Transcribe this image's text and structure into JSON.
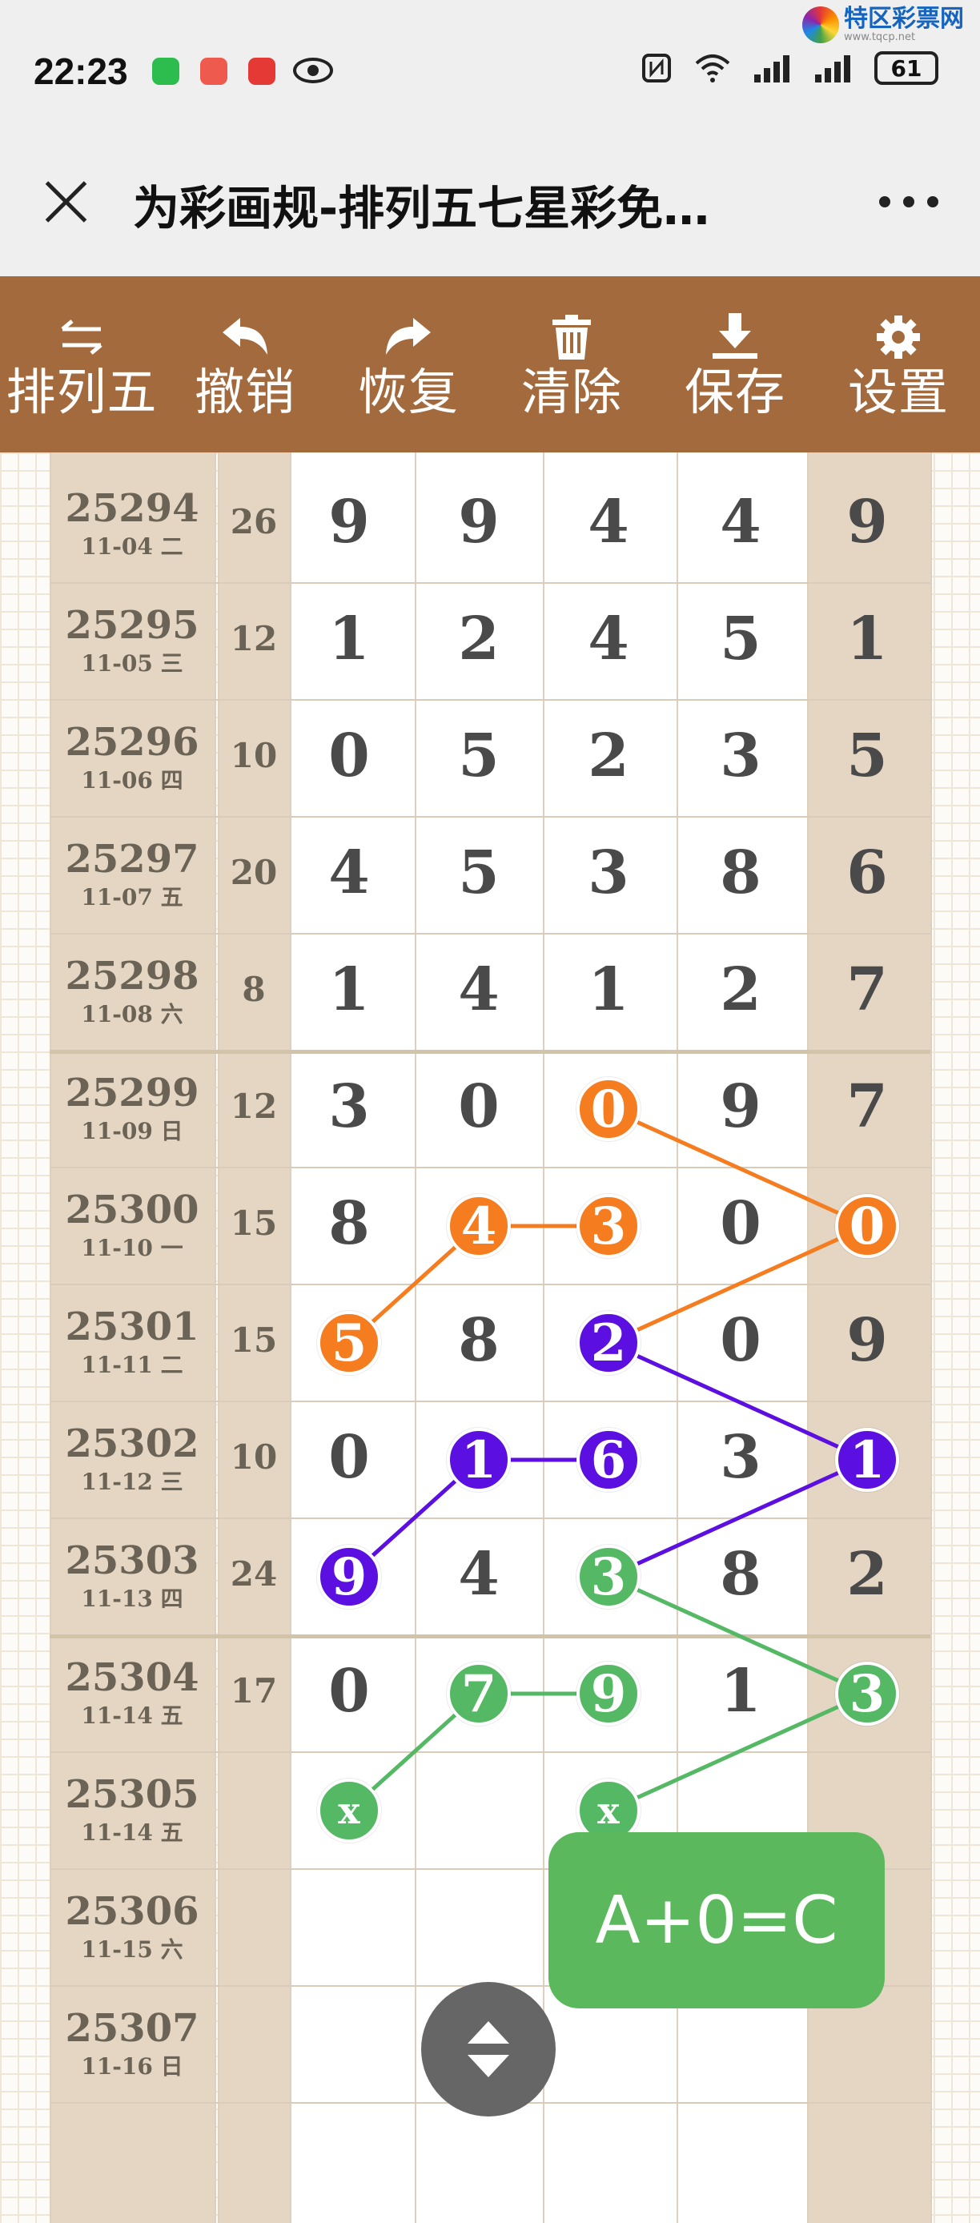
{
  "status": {
    "time": "22:23",
    "battery": "61",
    "watermark_text": "特区彩票网",
    "watermark_sub": "www.tqcp.net"
  },
  "header": {
    "title": "为彩画规-排列五七星彩免…"
  },
  "toolbar": [
    {
      "label": "排列五",
      "icon": "swap-arrows-icon"
    },
    {
      "label": "撤销",
      "icon": "undo-icon"
    },
    {
      "label": "恢复",
      "icon": "redo-icon"
    },
    {
      "label": "清除",
      "icon": "trash-icon"
    },
    {
      "label": "保存",
      "icon": "download-icon"
    },
    {
      "label": "设置",
      "icon": "gear-icon"
    }
  ],
  "rows": [
    {
      "issue": "25294",
      "date": "11-04 二",
      "sum": "26",
      "digits": [
        "9",
        "9",
        "4",
        "4",
        "9"
      ]
    },
    {
      "issue": "25295",
      "date": "11-05 三",
      "sum": "12",
      "digits": [
        "1",
        "2",
        "4",
        "5",
        "1"
      ]
    },
    {
      "issue": "25296",
      "date": "11-06 四",
      "sum": "10",
      "digits": [
        "0",
        "5",
        "2",
        "3",
        "5"
      ]
    },
    {
      "issue": "25297",
      "date": "11-07 五",
      "sum": "20",
      "digits": [
        "4",
        "5",
        "3",
        "8",
        "6"
      ]
    },
    {
      "issue": "25298",
      "date": "11-08 六",
      "sum": "8",
      "digits": [
        "1",
        "4",
        "1",
        "2",
        "7"
      ]
    },
    {
      "issue": "25299",
      "date": "11-09 日",
      "sum": "12",
      "digits": [
        "3",
        "0",
        "0",
        "9",
        "7"
      ]
    },
    {
      "issue": "25300",
      "date": "11-10 一",
      "sum": "15",
      "digits": [
        "8",
        "4",
        "3",
        "0",
        "0"
      ]
    },
    {
      "issue": "25301",
      "date": "11-11 二",
      "sum": "15",
      "digits": [
        "5",
        "8",
        "2",
        "0",
        "9"
      ]
    },
    {
      "issue": "25302",
      "date": "11-12 三",
      "sum": "10",
      "digits": [
        "0",
        "1",
        "6",
        "3",
        "1"
      ]
    },
    {
      "issue": "25303",
      "date": "11-13 四",
      "sum": "24",
      "digits": [
        "9",
        "4",
        "3",
        "8",
        "2"
      ]
    },
    {
      "issue": "25304",
      "date": "11-14 五",
      "sum": "17",
      "digits": [
        "0",
        "7",
        "9",
        "1",
        "3"
      ]
    },
    {
      "issue": "25305",
      "date": "11-14 五",
      "sum": "",
      "digits": [
        "x",
        "",
        "x",
        "",
        ""
      ]
    },
    {
      "issue": "25306",
      "date": "11-15 六",
      "sum": "",
      "digits": [
        "",
        "",
        "",
        "",
        ""
      ]
    },
    {
      "issue": "25307",
      "date": "11-16 日",
      "sum": "",
      "digits": [
        "",
        "",
        "",
        "",
        ""
      ]
    }
  ],
  "highlights": [
    {
      "row": 5,
      "col": 2,
      "color": "orange"
    },
    {
      "row": 6,
      "col": 1,
      "color": "orange"
    },
    {
      "row": 6,
      "col": 2,
      "color": "orange"
    },
    {
      "row": 6,
      "col": 4,
      "color": "orange"
    },
    {
      "row": 7,
      "col": 0,
      "color": "orange"
    },
    {
      "row": 7,
      "col": 2,
      "color": "purple"
    },
    {
      "row": 8,
      "col": 1,
      "color": "purple"
    },
    {
      "row": 8,
      "col": 2,
      "color": "purple"
    },
    {
      "row": 8,
      "col": 4,
      "color": "purple"
    },
    {
      "row": 9,
      "col": 0,
      "color": "purple"
    },
    {
      "row": 9,
      "col": 2,
      "color": "green"
    },
    {
      "row": 10,
      "col": 1,
      "color": "green"
    },
    {
      "row": 10,
      "col": 2,
      "color": "green"
    },
    {
      "row": 10,
      "col": 4,
      "color": "green"
    },
    {
      "row": 11,
      "col": 0,
      "color": "green"
    },
    {
      "row": 11,
      "col": 2,
      "color": "green"
    }
  ],
  "connections": [
    {
      "color": "orange",
      "points": [
        [
          5,
          2
        ],
        [
          6,
          4
        ],
        [
          7,
          2
        ]
      ]
    },
    {
      "color": "orange",
      "points": [
        [
          7,
          0
        ],
        [
          6,
          1
        ],
        [
          6,
          2
        ]
      ]
    },
    {
      "color": "purple",
      "points": [
        [
          7,
          2
        ],
        [
          8,
          4
        ],
        [
          9,
          2
        ]
      ]
    },
    {
      "color": "purple",
      "points": [
        [
          9,
          0
        ],
        [
          8,
          1
        ],
        [
          8,
          2
        ]
      ]
    },
    {
      "color": "green",
      "points": [
        [
          9,
          2
        ],
        [
          10,
          4
        ],
        [
          11,
          2
        ]
      ]
    },
    {
      "color": "green",
      "points": [
        [
          11,
          0
        ],
        [
          10,
          1
        ],
        [
          10,
          2
        ]
      ]
    }
  ],
  "colors": {
    "orange": "#f57c1f",
    "purple": "#5b0fe0",
    "green": "#55b864",
    "toolbar_bg": "#a36a3d"
  },
  "formula": "A+0=C"
}
